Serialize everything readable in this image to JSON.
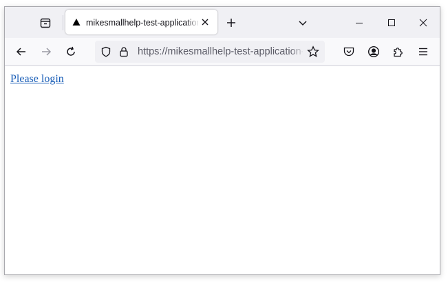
{
  "tab": {
    "title": "mikesmallhelp-test-application",
    "favicon": "triangle-icon"
  },
  "navbar": {
    "url": "https://mikesmallhelp-test-application-"
  },
  "page": {
    "link_text": "Please login",
    "link_color": "#1b5fb8"
  },
  "colors": {
    "tabstrip_bg": "#f0f0f4",
    "toolbar_bg": "#f9f9fb",
    "icon": "#15141a"
  }
}
